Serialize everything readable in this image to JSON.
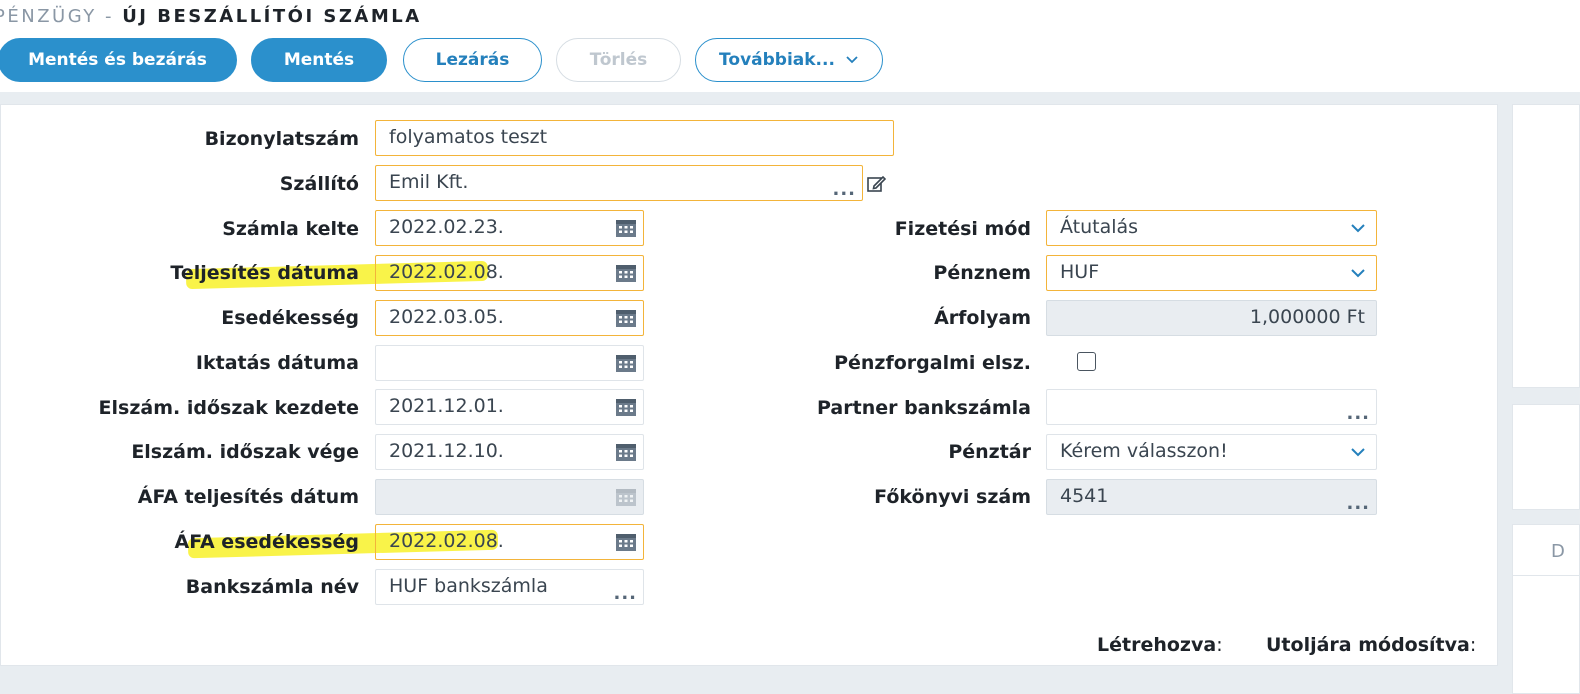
{
  "header": {
    "section": "PÉNZÜGY - ",
    "page_title": "ÚJ BESZÁLLÍTÓI SZÁMLA"
  },
  "toolbar": {
    "save_close": "Mentés és bezárás",
    "save": "Mentés",
    "close_record": "Lezárás",
    "delete": "Törlés",
    "more": "Továbbiak..."
  },
  "form_left": {
    "doc_number": {
      "label": "Bizonylatszám",
      "value": "folyamatos teszt"
    },
    "supplier": {
      "label": "Szállító",
      "value": "Emil Kft."
    },
    "invoice_date": {
      "label": "Számla kelte",
      "value": "2022.02.23."
    },
    "completion_date": {
      "label": "Teljesítés dátuma",
      "value": "2022.02.08."
    },
    "due_date": {
      "label": "Esedékesség",
      "value": "2022.03.05."
    },
    "filing_date": {
      "label": "Iktatás dátuma",
      "value": ""
    },
    "period_start": {
      "label": "Elszám. időszak kezdete",
      "value": "2021.12.01."
    },
    "period_end": {
      "label": "Elszám. időszak vége",
      "value": "2021.12.10."
    },
    "vat_completion": {
      "label": "ÁFA teljesítés dátum",
      "value": ""
    },
    "vat_due": {
      "label": "ÁFA esedékesség",
      "value": "2022.02.08."
    },
    "bank_account_name": {
      "label": "Bankszámla név",
      "value": "HUF bankszámla"
    }
  },
  "form_right": {
    "payment_method": {
      "label": "Fizetési mód",
      "value": "Átutalás"
    },
    "currency": {
      "label": "Pénznem",
      "value": "HUF"
    },
    "exchange_rate": {
      "label": "Árfolyam",
      "value": "1,000000 Ft"
    },
    "cash_accounting": {
      "label": "Pénzforgalmi elsz.",
      "checked": false
    },
    "partner_bank": {
      "label": "Partner bankszámla",
      "value": ""
    },
    "cashbox": {
      "label": "Pénztár",
      "value": "Kérem válasszon!"
    },
    "ledger_number": {
      "label": "Főkönyvi szám",
      "value": "4541"
    }
  },
  "footer": {
    "created": "Létrehozva",
    "modified": "Utoljára módosítva",
    "colon": ":"
  },
  "side": {
    "letter": "D"
  },
  "colors": {
    "accent": "#2b90cc",
    "required_border": "#f3b43a",
    "highlight": "#f8f235"
  }
}
